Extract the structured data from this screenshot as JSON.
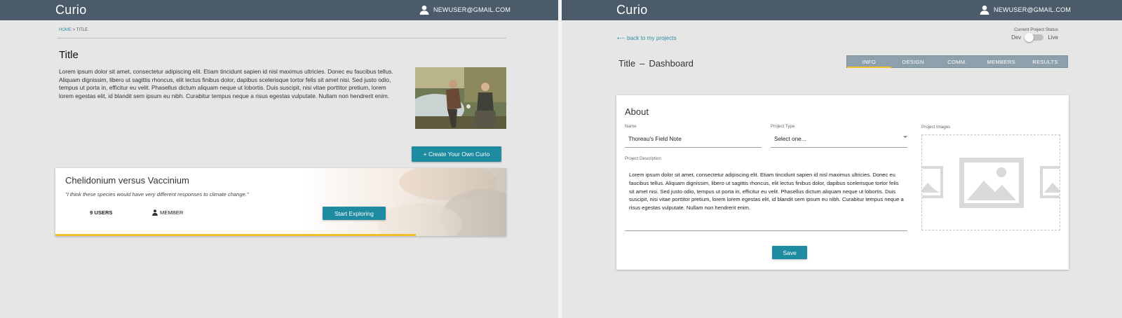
{
  "left_screen": {
    "header": {
      "brand": "Curio",
      "user_email": "NEWUSER@GMAIL.COM",
      "user_icon": "user-icon"
    },
    "breadcrumb": {
      "home": "HOME",
      "separator": ">",
      "current": "TITLE"
    },
    "page_title": "Title",
    "body_text": "Lorem ipsum dolor sit amet, consectetur adipiscing elit. Etiam tincidunt sapien id nisl maximus ultricies. Donec eu faucibus tellus. Aliquam dignissim, libero ut sagittis rhoncus, elit lectus finibus dolor, dapibus scelerisque tortor felis sit amet nisi. Sed justo odio, tempus ut porta in, efficitur eu velit. Phasellus dictum aliquam neque ut lobortis. Duis suscipit, nisi vitae porttitor pretium, lorem lorem egestas elit, id blandit sem ipsum eu nibh. Curabitur tempus neque a risus egestas vulputate. Nullam non hendrerit enim.",
    "create_button": "+ Create Your Own Curio",
    "card": {
      "title": "Chelidonium versus Vaccinium",
      "quote": "\"I think these species would have very different responses to climate change.\"",
      "users": "9 USERS",
      "role": "MEMBER",
      "role_icon": "person-icon",
      "cta": "Start Exploring",
      "progress": 0.8
    }
  },
  "right_screen": {
    "header": {
      "brand": "Curio",
      "user_email": "NEWUSER@GMAIL.COM",
      "user_icon": "user-icon"
    },
    "back_link": "⟵ back to my projects",
    "status": {
      "label": "Current Project Status",
      "left": "Dev",
      "right": "Live",
      "state": "Dev"
    },
    "title": "Title",
    "title_sep": "–",
    "title_suffix": "Dashboard",
    "tabs": [
      "INFO",
      "DESIGN",
      "COMM.",
      "MEMBERS",
      "RESULTS"
    ],
    "active_tab": "INFO",
    "about": {
      "heading": "About",
      "name_label": "Name",
      "name_value": "Thoreau's Field Note",
      "type_label": "Project Type",
      "type_value": "Select one...",
      "images_label": "Project Images",
      "desc_label": "Project Description",
      "desc_value": "Lorem ipsum dolor sit amet, consectetur adipiscing elit. Etiam tincidunt sapien id nisl maximus ultricies. Donec eu faucibus tellus. Aliquam dignissim, libero ut sagittis rhoncus, elit lectus finibus dolor, dapibus scelerisque tortor felis sit amet nisi. Sed justo odio, tempus ut porta in, efficitur eu velit. Phasellus dictum aliquam neque ut lobortis. Duis suscipit, nisi vitae porttitor pretium, lorem lorem egestas elit, id blandit sem ipsum eu nibh. Curabitur tempus neque a risus egestas vulputate. Nullam non hendrerit enim.",
      "save_button": "Save",
      "image_icon": "image-placeholder-icon"
    }
  },
  "colors": {
    "header_bg": "#4c5b69",
    "accent_teal": "#1e8ba0",
    "link_teal": "#2e8fa3",
    "tab_bg": "#8ea0ac",
    "progress_yellow": "#f0c02c",
    "page_bg": "#e6e6e6"
  }
}
